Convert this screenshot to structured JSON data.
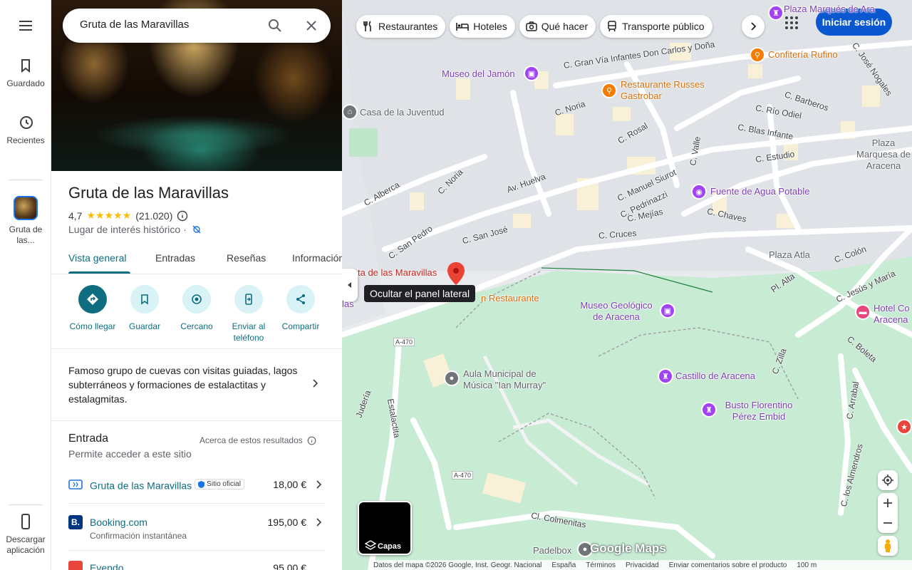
{
  "rail": {
    "menu_label": "Menú",
    "saved_label": "Guardado",
    "recents_label": "Recientes",
    "recent_place_label": "Gruta de las...",
    "download_label": "Descargar aplicación"
  },
  "search": {
    "value": "Gruta de las Maravillas"
  },
  "place": {
    "name": "Gruta de las Maravillas",
    "rating": "4,7",
    "stars": "★★★★★",
    "reviews": "(21.020)",
    "category": "Lugar de interés histórico ·"
  },
  "tabs": [
    {
      "label": "Vista general",
      "active": true
    },
    {
      "label": "Entradas"
    },
    {
      "label": "Reseñas"
    },
    {
      "label": "Información"
    }
  ],
  "actions": [
    {
      "label": "Cómo llegar"
    },
    {
      "label": "Guardar"
    },
    {
      "label": "Cercano"
    },
    {
      "label": "Enviar al teléfono"
    },
    {
      "label": "Compartir"
    }
  ],
  "description": "Famoso grupo de cuevas con visitas guiadas, lagos subterráneos y formaciones de estalactitas y estalagmitas.",
  "entrada": {
    "title": "Entrada",
    "subtitle": "Permite acceder a este sitio",
    "about": "Acerca de estos resultados",
    "offers": [
      {
        "name": "Gruta de las Maravillas",
        "badge": "Sitio oficial",
        "sub": "",
        "price": "18,00 €"
      },
      {
        "name": "Booking.com",
        "badge": "",
        "sub": "Confirmación instantánea",
        "price": "195,00 €"
      },
      {
        "name": "Evendo",
        "badge": "",
        "sub": "",
        "price": "95,00 €"
      }
    ]
  },
  "map": {
    "chips": [
      "Restaurantes",
      "Hoteles",
      "Qué hacer",
      "Transporte público"
    ],
    "signin": "Iniciar sesión",
    "tooltip": "Ocultar el panel lateral",
    "layers": "Capas",
    "google_logo": "Google Maps",
    "labels": {
      "plaza_marques_top": "Plaza Marqués de Ara",
      "confiteria": "Confitería Rufino",
      "museo_jamon": "Museo del Jamón",
      "restaurante_russes": "Restaurante Russes Gastrobar",
      "casa_juventud": "Casa de la Juventud",
      "plaza_marquesa": "Plaza Marquesa de Aracena",
      "fuente": "Fuente de Agua Potable",
      "plaza_atla": "Plaza Atla",
      "gruta_pin": "ta de las Maravillas",
      "restaurante_pin": "n Restaurante",
      "museo_geologico": "Museo Geológico de Aracena",
      "hotel": "Hotel Co Aracena",
      "aula_musica": "Aula Municipal de Música \"Ian Murray\"",
      "castillo": "Castillo de Aracena",
      "busto": "Busto Florentino Pérez Embid",
      "padelbox": "Padelbox",
      "las_label": "las"
    },
    "streets": {
      "gran_via": "C. Gran Vía Infantes Don Carlos y Doña",
      "jose_nogales": "C. José Nogales",
      "barberos": "C. Barberos",
      "noria_top": "C. Noria",
      "rio_odiel": "C. Río Odiel",
      "rosal": "C. Rosal",
      "blas_infante": "C. Blas Infante",
      "estudio": "C. Estudio",
      "valle": "C. Valle",
      "alberca": "C. Alberca",
      "noria": "C. Noria",
      "av_huelva": "Av. Huelva",
      "manuel_siurot": "C. Manuel Siurot",
      "pedrinazzi": "C. Pedrinazzi",
      "mejias": "C. Mejías",
      "chaves": "C. Chaves",
      "san_pedro": "C. San Pedro",
      "san_jose": "C. San José",
      "cruces": "C. Cruces",
      "colon": "C. Colón",
      "pl_alta": "Pl. Alta",
      "jesus_maria": "C. Jesús y María",
      "boleta": "C. Boleta",
      "zilla": "C. Zilla",
      "juderia": "Judería",
      "estalactita": "Estalactita",
      "arrabal": "C. Arrabal",
      "almendros": "C. los Almendros",
      "colmenitas": "Cl. Colmenitas",
      "a470_1": "A-470",
      "a470_2": "A-470"
    },
    "footer": [
      "Datos del mapa ©2026 Google, Inst. Geogr. Nacional",
      "España",
      "Términos",
      "Privacidad",
      "Enviar comentarios sobre el producto",
      "100 m"
    ]
  }
}
